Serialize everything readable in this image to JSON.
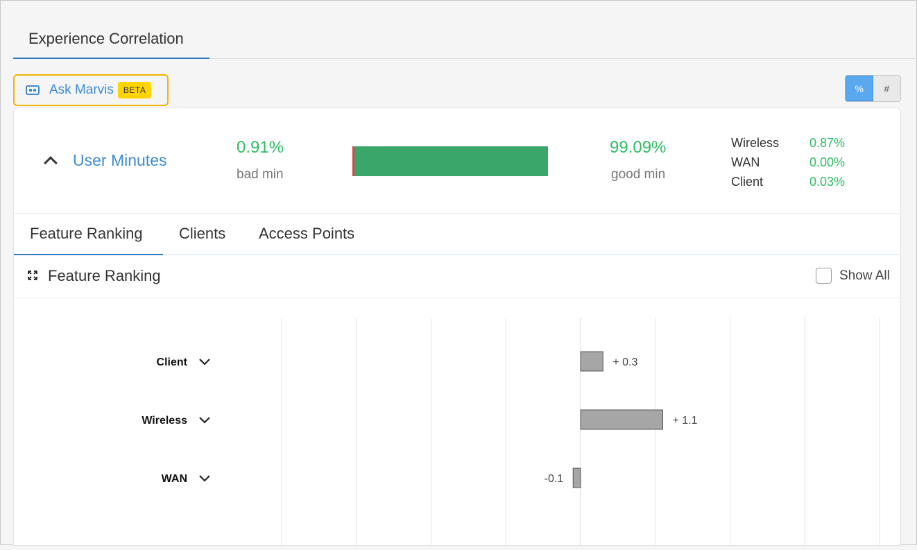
{
  "top_tab": "Experience Correlation",
  "ask_marvis": {
    "label": "Ask Marvis",
    "badge": "BETA"
  },
  "toggle": {
    "percent": "%",
    "count": "#",
    "active": "percent"
  },
  "summary": {
    "title": "User Minutes",
    "bad_value": "0.91%",
    "bad_label": "bad min",
    "good_value": "99.09%",
    "good_label": "good min",
    "bar": {
      "bad_percent": 0.91,
      "good_percent": 99.09
    },
    "breakdown": [
      {
        "name": "Wireless",
        "value": "0.87%"
      },
      {
        "name": "WAN",
        "value": "0.00%"
      },
      {
        "name": "Client",
        "value": "0.03%"
      }
    ]
  },
  "sub_tabs": [
    {
      "label": "Feature Ranking",
      "active": true
    },
    {
      "label": "Clients",
      "active": false
    },
    {
      "label": "Access Points",
      "active": false
    }
  ],
  "feature_ranking": {
    "title": "Feature Ranking",
    "show_all": "Show All"
  },
  "chart_data": {
    "type": "bar",
    "orientation": "horizontal",
    "categories": [
      "Client",
      "Wireless",
      "WAN"
    ],
    "values": [
      0.3,
      1.1,
      -0.1
    ],
    "value_labels": [
      "+ 0.3",
      "+ 1.1",
      "-0.1"
    ],
    "xlim": [
      -4,
      4
    ],
    "grid": true,
    "bar_color": "#a6a6a6"
  },
  "colors": {
    "accent": "#3f8bd1",
    "good": "#2ebd63",
    "bad": "#e04545",
    "highlight": "#f5b400"
  }
}
